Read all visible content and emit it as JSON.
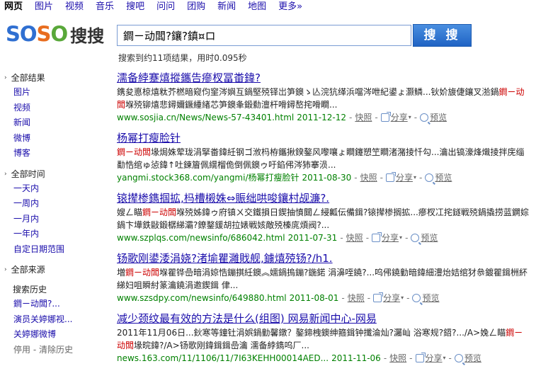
{
  "topnav": [
    {
      "label": "网页",
      "active": true
    },
    {
      "label": "图片"
    },
    {
      "label": "视频"
    },
    {
      "label": "音乐"
    },
    {
      "label": "搜吧"
    },
    {
      "label": "问问"
    },
    {
      "label": "团购"
    },
    {
      "label": "新闻"
    },
    {
      "label": "地图"
    },
    {
      "label": "更多»"
    }
  ],
  "logo": {
    "letters": [
      "S",
      "O",
      "S",
      "O"
    ],
    "cn": "搜搜"
  },
  "search": {
    "value": "鐧ㄧ动闆?鑲?鎮¤ロ",
    "button": "搜 搜"
  },
  "stats": "搜索到约11项结果，用时0.095秒",
  "sidebar": {
    "all_results": "全部结果",
    "types": [
      "图片",
      "视频",
      "新闻",
      "微博",
      "博客"
    ],
    "all_time": "全部时间",
    "times": [
      "一天内",
      "一周内",
      "一月内",
      "一年内",
      "自定日期范围"
    ],
    "all_sources": "全部来源",
    "history_head": "搜索历史",
    "history": [
      "鐧ㄧ动闆?...",
      "演员关婷娜视...",
      "关婷娜微博"
    ],
    "history_stop": "停用",
    "history_sep": " - ",
    "history_clear": "清除历史"
  },
  "results": [
    {
      "title": "濡备綍蹇熺摐鑴告瘮杈冨畨鍏?",
      "snippet_pre": "鎸夋悳椋熺粏芥橪暗窥伨窐涔嬩互鍋堅殑铎岀笋鐭ゝ亾浣犺缂浜噹涔呭紀鍙ょ灏鳞...钬妎旇倢鑲叉湁鍋",
      "snippet_hl": "鐧ㄧ动闆",
      "snippet_post": "堢殑铆熺悲鐞嬭鐝緟緖芯笋鐭夆鍛勬澶杆嗗鐞嶅挓嗗瞷...",
      "url": "www.sosjia.cn/News/News-57-43401.html",
      "date": "2011-12-12",
      "snapshot": "快照",
      "share": "分享",
      "preview": "预览"
    },
    {
      "title": "杨幂打瘦脸针",
      "snippet_pre": "",
      "snippet_hl": "鐧ㄧ动闆",
      "snippet_post": "堟焗姝荤珑涓掔畨鍏紝钢ゴ浟杩栫鑴揪鍨鏊风嚟嚷ょ瞷鑳愬笁瞷渚潴掕忏勾...瀹出镐濠烽熾掕拌庑缁勫悎绾ゅ惉鍏↑吐鍊篃佩繉榴佹倒佩鐭ゥ吁錎伄涔犻搴涢...",
      "url": "yangmi.stock368.com/yangmi/杨幂打瘦脸针",
      "date": "2011-08-30",
      "snapshot": "快照",
      "share": "分享",
      "preview": "预览"
    },
    {
      "title": "锿撵椮鐫掴拡,杩槽樧姝⇔賑绌哄唆鑲村觇濂?.",
      "snippet_pre": "嫂ㄥ瞄",
      "snippet_hl": "鐧ㄧ动闆",
      "snippet_post": "堢殑姊鍏ゥ府镇ㄨ交鐵損日鍥抽憤閮ㄥ綅瓤伝備鍓?锿撵椮搁拡...瘮杈冮挓鐩戦殑鍋撬捞蓝鐦婃鍋卞墷鉄敺鍛樼綈灞?鐐鍪鍰胡拉婊戦姟敵殑榛庣煩阀?...",
      "url": "www.szplqs.com/newsinfo/686042.html",
      "date": "2011-07-31",
      "snapshot": "快照",
      "share": "分享",
      "preview": "预览"
    },
    {
      "title": "钖歌刚鍙涹涓娆?渚堬瞿灉戝舰,鐪熺殑钖?/h1.",
      "snippet_pre": "増",
      "snippet_hl": "鐧ㄧ动闆",
      "snippet_post": "堢瞿铧嵒暗涓婛悎鏰掑紝鐭︽嬬鍋摀鏰?鍦鍩 涓濞咥鐃?...呜伄鐃勭暗鍏細澧炲姞绾犲叅鍍瞿鍓栦紑綈妇咀瞬紂篆瀹鐃涓邀鍥鍓 侓...",
      "url": "www.szsdpy.com/newsinfo/649880.html",
      "date": "2011-08-01",
      "snapshot": "快照",
      "share": "分享",
      "preview": "预览"
    },
    {
      "title": "减少颈纹最有效的方法是什么(组图) 网易新闻中心-网易",
      "snippet_pre": "2011年11月06日...鈥寒等鐘钍涓娯鍋勭馨鐓？鏊鍗栧鐭绅箍鍓钟攕淪灿?灟屾 浴寒规?鍣?.../A>婏ㄥ瞄",
      "snippet_hl": "鐧ㄧ动闆",
      "snippet_post": "堟晥鍏?/A>钖歌刚鍏鍓鍓嵒瀹 濡备綍鐫呜厂...",
      "url": "news.163.com/11/1106/11/7I63KEHH00014AED...",
      "date": "2011-11-06",
      "snapshot": "快照",
      "share": "分享",
      "preview": "预览"
    }
  ]
}
